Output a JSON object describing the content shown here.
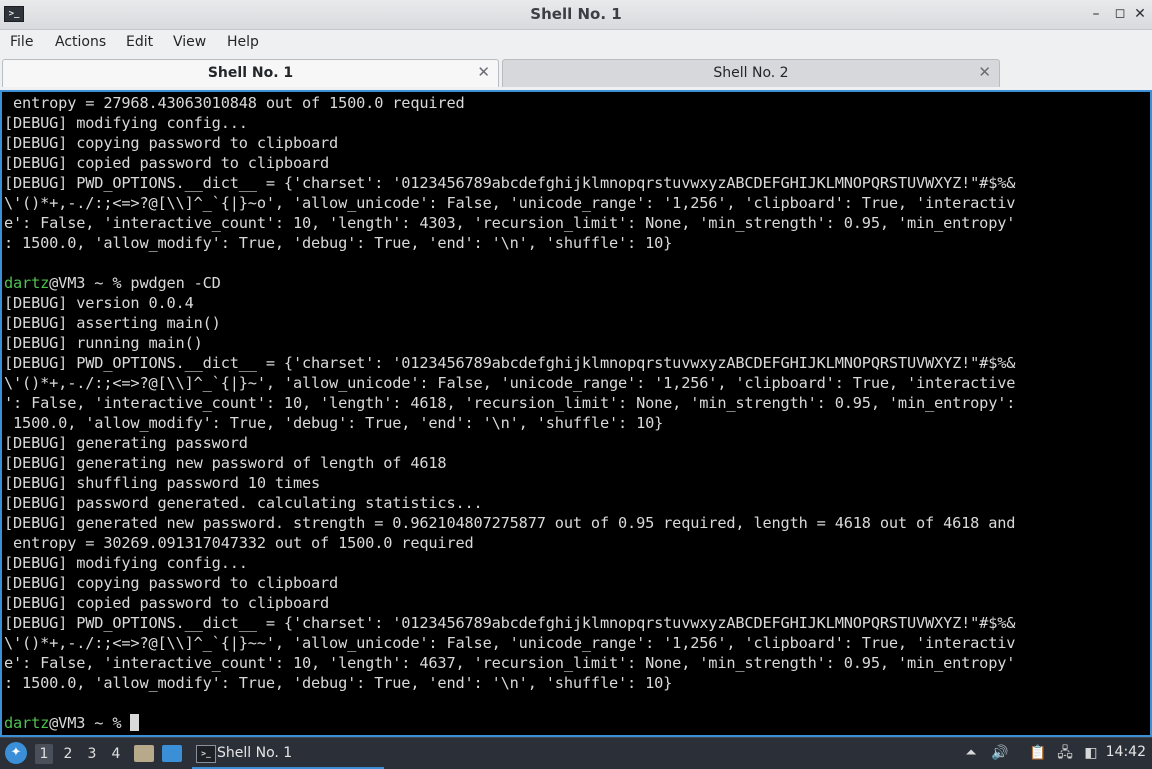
{
  "window": {
    "title": "Shell No. 1",
    "minimize_glyph": "–",
    "maximize_glyph": "◻",
    "close_glyph": "✕"
  },
  "menu": {
    "file": "File",
    "actions": "Actions",
    "edit": "Edit",
    "view": "View",
    "help": "Help"
  },
  "tabs": [
    {
      "label": "Shell No. 1",
      "close": "✕"
    },
    {
      "label": "Shell No. 2",
      "close": "✕"
    }
  ],
  "terminal": {
    "user": "dartz",
    "host_prompt": "@VM3 ~ % ",
    "command": "pwdgen -CD",
    "block1": " entropy = 27968.43063010848 out of 1500.0 required\n[DEBUG] modifying config...\n[DEBUG] copying password to clipboard\n[DEBUG] copied password to clipboard\n[DEBUG] PWD_OPTIONS.__dict__ = {'charset': '0123456789abcdefghijklmnopqrstuvwxyzABCDEFGHIJKLMNOPQRSTUVWXYZ!\"#$%&\n\\'()*+,-./:;<=>?@[\\\\]^_`{|}~o', 'allow_unicode': False, 'unicode_range': '1,256', 'clipboard': True, 'interactiv\ne': False, 'interactive_count': 10, 'length': 4303, 'recursion_limit': None, 'min_strength': 0.95, 'min_entropy'\n: 1500.0, 'allow_modify': True, 'debug': True, 'end': '\\n', 'shuffle': 10}\n",
    "block2": "[DEBUG] version 0.0.4\n[DEBUG] asserting main()\n[DEBUG] running main()\n[DEBUG] PWD_OPTIONS.__dict__ = {'charset': '0123456789abcdefghijklmnopqrstuvwxyzABCDEFGHIJKLMNOPQRSTUVWXYZ!\"#$%&\n\\'()*+,-./:;<=>?@[\\\\]^_`{|}~', 'allow_unicode': False, 'unicode_range': '1,256', 'clipboard': True, 'interactive\n': False, 'interactive_count': 10, 'length': 4618, 'recursion_limit': None, 'min_strength': 0.95, 'min_entropy':\n 1500.0, 'allow_modify': True, 'debug': True, 'end': '\\n', 'shuffle': 10}\n[DEBUG] generating password\n[DEBUG] generating new password of length of 4618\n[DEBUG] shuffling password 10 times\n[DEBUG] password generated. calculating statistics...\n[DEBUG] generated new password. strength = 0.962104807275877 out of 0.95 required, length = 4618 out of 4618 and\n entropy = 30269.091317047332 out of 1500.0 required\n[DEBUG] modifying config...\n[DEBUG] copying password to clipboard\n[DEBUG] copied password to clipboard\n[DEBUG] PWD_OPTIONS.__dict__ = {'charset': '0123456789abcdefghijklmnopqrstuvwxyzABCDEFGHIJKLMNOPQRSTUVWXYZ!\"#$%&\n\\'()*+,-./:;<=>?@[\\\\]^_`{|}~~', 'allow_unicode': False, 'unicode_range': '1,256', 'clipboard': True, 'interactiv\ne': False, 'interactive_count': 10, 'length': 4637, 'recursion_limit': None, 'min_strength': 0.95, 'min_entropy'\n: 1500.0, 'allow_modify': True, 'debug': True, 'end': '\\n', 'shuffle': 10}\n"
  },
  "taskbar": {
    "desktops": [
      "1",
      "2",
      "3",
      "4"
    ],
    "task_label": "Shell No. 1",
    "clock": "14:42"
  },
  "colors": {
    "terminal_bg": "#000000",
    "terminal_fg": "#d9d9d9",
    "prompt_user": "#4ec24e",
    "accent": "#3b8fd6",
    "taskbar_bg": "#2b3038"
  }
}
